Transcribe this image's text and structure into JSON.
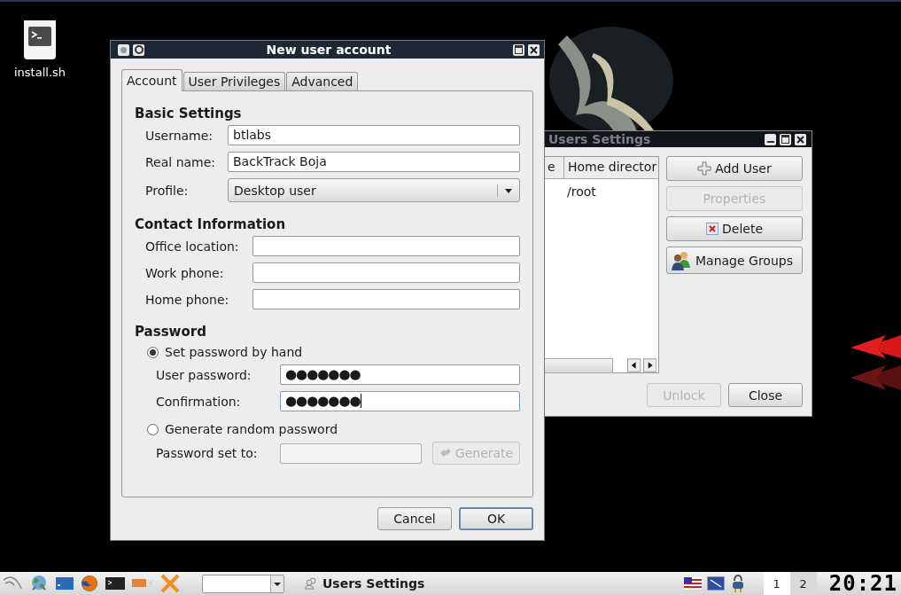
{
  "desktop_icons": [
    {
      "label": "install.sh"
    }
  ],
  "users_window": {
    "title": "Users Settings",
    "columns": [
      {
        "label": "e"
      },
      {
        "label": "Home director"
      }
    ],
    "rows": [
      {
        "home_directory": "/root"
      }
    ],
    "side_buttons": [
      {
        "label": "Add User",
        "kind": "add",
        "disabled": false
      },
      {
        "label": "Properties",
        "kind": "plain",
        "disabled": true
      },
      {
        "label": "Delete",
        "kind": "delete",
        "disabled": false
      },
      {
        "label": "Manage Groups",
        "kind": "groups",
        "disabled": false
      }
    ],
    "bottom_buttons": [
      {
        "label": "Unlock",
        "disabled": true
      },
      {
        "label": "Close",
        "disabled": false
      }
    ]
  },
  "dialog": {
    "title": "New user account",
    "tabs": [
      {
        "label": "Account",
        "selected": true
      },
      {
        "label": "User Privileges",
        "selected": false
      },
      {
        "label": "Advanced",
        "selected": false
      }
    ],
    "basic_settings": {
      "heading": "Basic Settings",
      "fields": [
        {
          "label": "Username:",
          "kind": "text",
          "value": "btlabs"
        },
        {
          "label": "Real name:",
          "kind": "text",
          "value": "BackTrack Boja"
        },
        {
          "label": "Profile:",
          "kind": "dropdown",
          "value": "Desktop user"
        }
      ]
    },
    "contact_information": {
      "heading": "Contact Information",
      "fields": [
        {
          "label": "Office location:"
        },
        {
          "label": "Work phone:"
        },
        {
          "label": "Home phone:"
        }
      ]
    },
    "password": {
      "heading": "Password",
      "options": [
        {
          "label": "Set password by hand",
          "selected": true,
          "fields": [
            {
              "label": "User password:",
              "value": "●●●●●●●",
              "focused": false,
              "disabled": false
            },
            {
              "label": "Confirmation:",
              "value": "●●●●●●●",
              "focused": true,
              "disabled": false
            }
          ]
        },
        {
          "label": "Generate random password",
          "selected": false,
          "fields": [
            {
              "label": "Password set to:",
              "focused": false,
              "disabled": true
            }
          ],
          "button": {
            "label": "Generate",
            "disabled": true
          }
        }
      ]
    },
    "buttons": [
      {
        "label": "Cancel",
        "default": false
      },
      {
        "label": "OK",
        "default": true
      }
    ]
  },
  "taskbar": {
    "task": {
      "label": "Users Settings"
    },
    "workspaces": [
      {
        "label": "1",
        "selected": true
      },
      {
        "label": "2",
        "selected": false
      }
    ],
    "clock": "20:21"
  }
}
